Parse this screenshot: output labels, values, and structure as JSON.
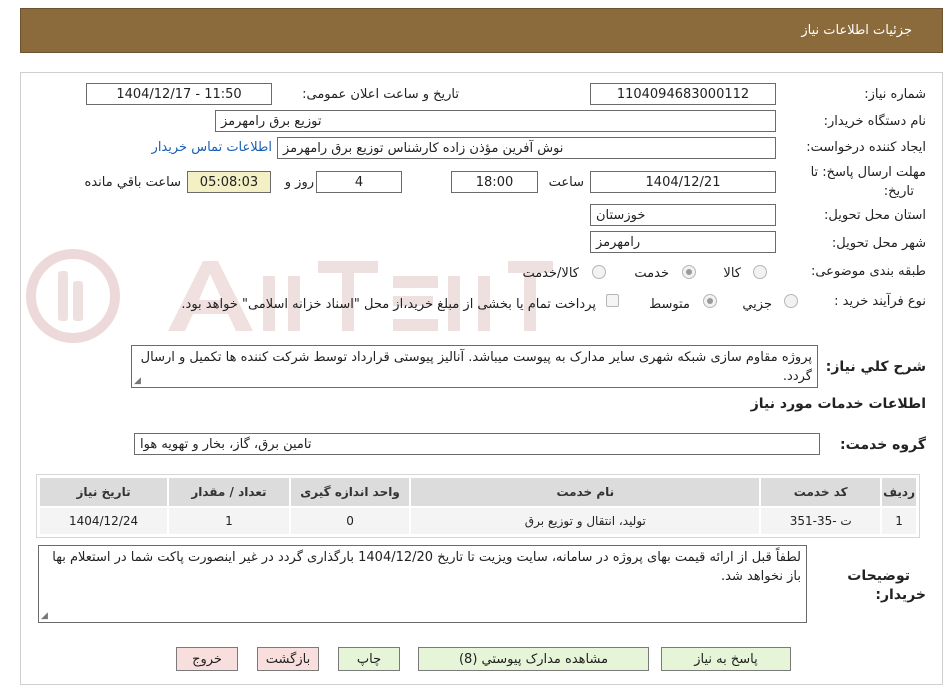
{
  "header": {
    "title": "جزئیات اطلاعات نیاز"
  },
  "form": {
    "need_number_label": "شماره نیاز:",
    "need_number": "1104094683000112",
    "announce_label": "تاریخ و ساعت اعلان عمومی:",
    "announce_value": "1404/12/17 - 11:50",
    "buyer_org_label": "نام دستگاه خریدار:",
    "buyer_org": "توزیع برق رامهرمز",
    "requester_label": "ایجاد کننده درخواست:",
    "requester": "نوش آفرین مؤذن زاده کارشناس توزیع برق رامهرمز",
    "contact_link": "اطلاعات تماس خریدار",
    "deadline_label_1": "مهلت ارسال پاسخ: تا",
    "deadline_label_2": "تاریخ:",
    "deadline_date": "1404/12/21",
    "time_label": "ساعت",
    "deadline_time": "18:00",
    "days_value": "4",
    "days_label": "روز و",
    "remaining_time": "05:08:03",
    "remaining_label": "ساعت باقي مانده",
    "province_label": "استان محل تحویل:",
    "province": "خوزستان",
    "city_label": "شهر محل تحویل:",
    "city": "رامهرمز",
    "category_label": "طبقه بندی موضوعی:",
    "category_options": [
      "کالا",
      "خدمت",
      "کالا/خدمت"
    ],
    "category_selected": "خدمت",
    "process_label": "نوع فرآیند خرید :",
    "process_options": [
      "جزيي",
      "متوسط"
    ],
    "process_selected": "متوسط",
    "payment_note": "پرداخت تمام یا بخشی از مبلغ خرید،از محل \"اسناد خزانه اسلامی\" خواهد بود.",
    "description_label": "شرح کلي نیاز:",
    "description": "پروژه مقاوم سازی شبکه شهری سایر مدارک به پیوست میباشد. آنالیز پیوستی قرارداد توسط شرکت کننده ها تکمیل و ارسال گردد."
  },
  "services": {
    "section_title": "اطلاعات خدمات مورد نیاز",
    "group_label": "گروه خدمت:",
    "group_value": "تامین برق، گاز، بخار و تهویه هوا",
    "columns": [
      "ردیف",
      "کد خدمت",
      "نام خدمت",
      "واحد اندازه گیری",
      "تعداد / مقدار",
      "تاریخ نیاز"
    ],
    "rows": [
      {
        "row": "1",
        "code": "ت -35-351",
        "name": "تولید، انتقال و توزیع برق",
        "unit": "0",
        "qty": "1",
        "date": "1404/12/24"
      }
    ]
  },
  "buyer_notes": {
    "label_1": "توضیحات",
    "label_2": "خریدار:",
    "text": "لطفاً قبل از ارائه قیمت بهای پروژه در سامانه، سایت ویزیت تا تاریخ 1404/12/20 بارگذاری گردد در غیر اینصورت پاکت شما در استعلام بها باز نخواهد شد."
  },
  "buttons": {
    "reply": "پاسخ به نیاز",
    "attachments": "مشاهده مدارک پیوستي (8)",
    "print": "چاپ",
    "back": "بازگشت",
    "exit": "خروج"
  },
  "colors": {
    "header_bg": "#8b6a3c",
    "button_green": "#e6f4d8",
    "button_pink": "#f9dede",
    "link": "#1a5fb4"
  }
}
